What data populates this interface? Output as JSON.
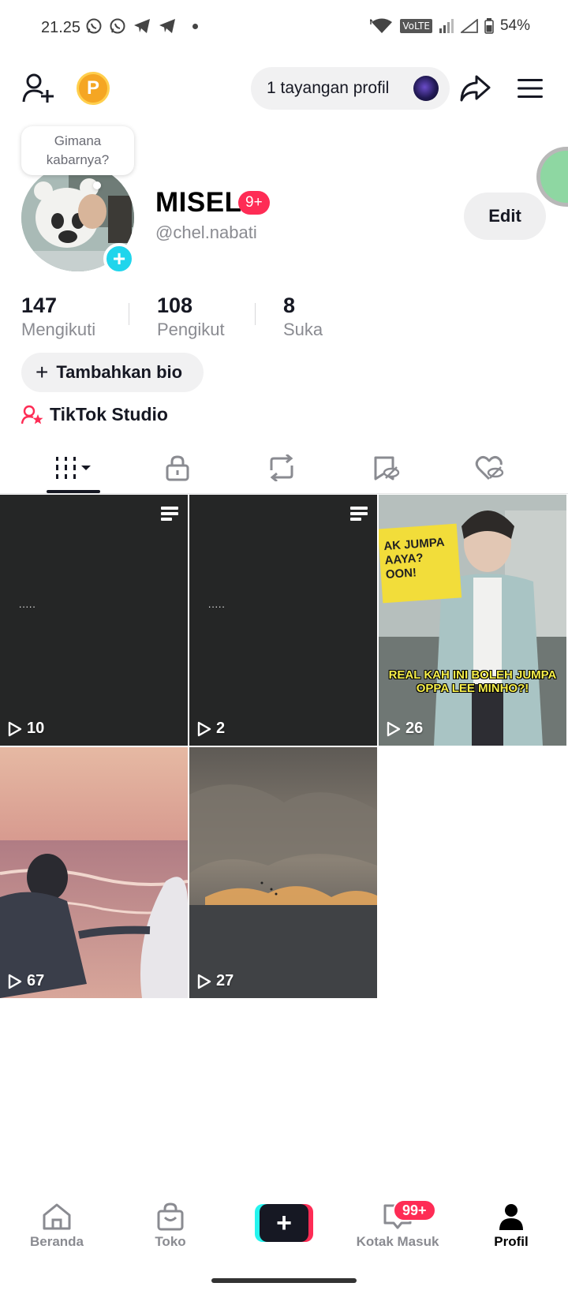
{
  "status_bar": {
    "time": "21.25",
    "volte": "VoLTE",
    "battery": "54%"
  },
  "top_bar": {
    "coin_letter": "P",
    "profile_views": "1 tayangan profil"
  },
  "profile": {
    "bubble_text": "Gimana kabarnya?",
    "name": "MISEL",
    "notification_badge": "9+",
    "handle": "@chel.nabati",
    "edit_label": "Edit"
  },
  "stats": [
    {
      "value": "147",
      "label": "Mengikuti"
    },
    {
      "value": "108",
      "label": "Pengikut"
    },
    {
      "value": "8",
      "label": "Suka"
    }
  ],
  "bio_button": "Tambahkan bio",
  "studio_link": "TikTok Studio",
  "tabs": [
    "videos-icon",
    "lock-icon",
    "repost-icon",
    "saved-icon",
    "liked-icon"
  ],
  "videos": [
    {
      "views": "10",
      "kind": "text-post"
    },
    {
      "views": "2",
      "kind": "text-post"
    },
    {
      "views": "26",
      "kind": "photo",
      "caption": "REAL KAH INI BOLEH JUMPA OPPA LEE MINHO?!",
      "sign_text": "AK JUMPA AAYA? OON!"
    },
    {
      "views": "67",
      "kind": "beach"
    },
    {
      "views": "27",
      "kind": "clouds"
    }
  ],
  "bottom_nav": {
    "home": "Beranda",
    "shop": "Toko",
    "inbox": "Kotak Masuk",
    "inbox_badge": "99+",
    "profile": "Profil"
  },
  "colors": {
    "accent": "#fe2c55",
    "cyan": "#25f4ee",
    "text": "#161823",
    "muted": "#8a8b91"
  }
}
